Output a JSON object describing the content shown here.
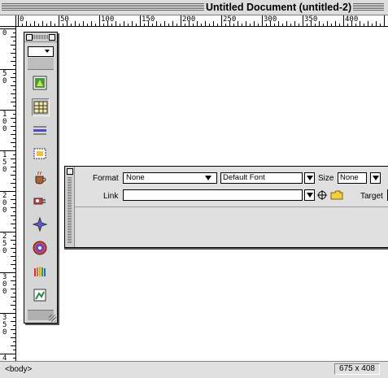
{
  "window": {
    "title": "Untitled Document (untitled-2)"
  },
  "ruler": {
    "h_labels": [
      "0",
      "50",
      "100",
      "150",
      "200",
      "250",
      "300",
      "350",
      "400"
    ],
    "v_labels": [
      "0",
      "50",
      "100",
      "150",
      "200",
      "250",
      "300",
      "350",
      "4"
    ]
  },
  "objects_palette": {
    "category_value": "",
    "icons": [
      "image-icon",
      "table-icon",
      "horizontal-rule-icon",
      "layer-icon",
      "java-applet-icon",
      "plugin-icon",
      "activex-icon",
      "shockwave-icon",
      "flash-icon",
      "generator-icon"
    ]
  },
  "property_inspector": {
    "format_label": "Format",
    "format_value": "None",
    "font_value": "Default Font",
    "size_label": "Size",
    "size_value": "None",
    "link_label": "Link",
    "link_value": "",
    "target_label": "Target"
  },
  "status_bar": {
    "tag_selector": "<body>",
    "window_size": "675 x 408"
  },
  "colors": {
    "chrome": "#e0e0e0",
    "palette": "#d6d6d6",
    "document": "#ffffff"
  }
}
